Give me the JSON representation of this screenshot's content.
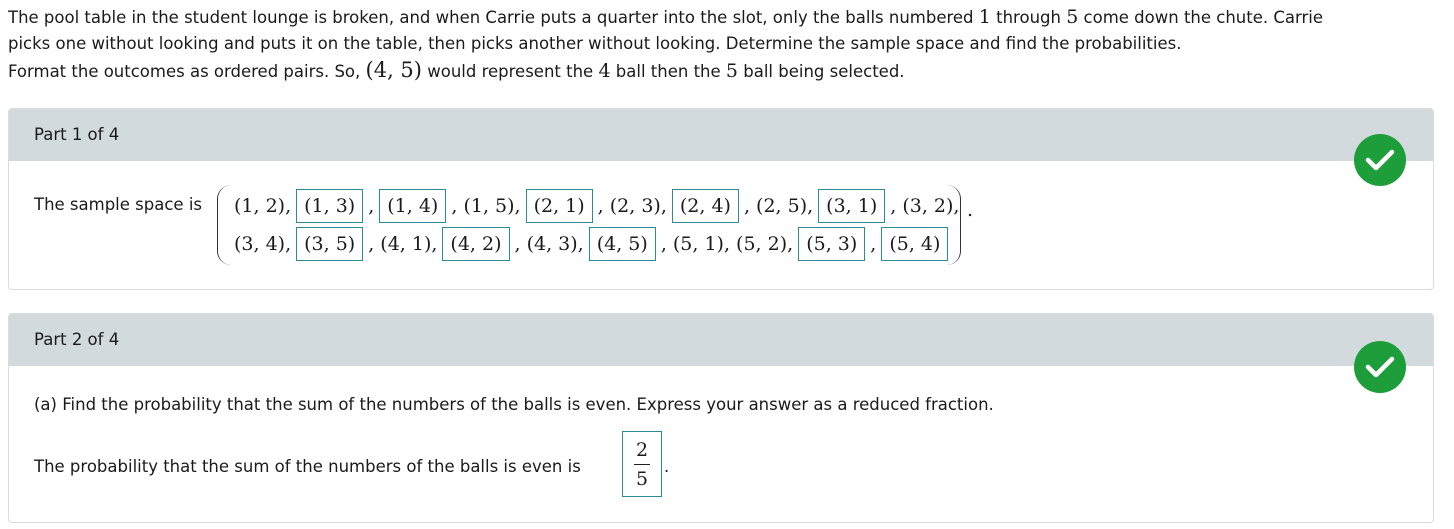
{
  "problem": {
    "line1_a": "The pool table in the student lounge is broken, and when Carrie puts a quarter into the slot, only the balls numbered ",
    "line1_n1": "1",
    "line1_b": " through ",
    "line1_n2": "5",
    "line1_c": " come down the chute. Carrie",
    "line2": "picks one without looking and puts it on the table, then picks another without looking. Determine the sample space and find the probabilities.",
    "line3_a": "Format the outcomes as ordered pairs. So, ",
    "line3_pair": "(4, 5)",
    "line3_b": " would represent the ",
    "line3_n1": "4",
    "line3_c": " ball then the ",
    "line3_n2": "5",
    "line3_d": " ball being selected."
  },
  "part1": {
    "header": "Part 1 of 4",
    "label": "The sample space is",
    "row1": [
      {
        "v": "(1, 2),",
        "boxed": false
      },
      {
        "v": "(1, 3)",
        "boxed": true
      },
      {
        "v": ",",
        "boxed": false
      },
      {
        "v": "(1, 4)",
        "boxed": true
      },
      {
        "v": ", (1, 5),",
        "boxed": false
      },
      {
        "v": "(2, 1)",
        "boxed": true
      },
      {
        "v": ", (2, 3),",
        "boxed": false
      },
      {
        "v": "(2, 4)",
        "boxed": true
      },
      {
        "v": ", (2, 5),",
        "boxed": false
      },
      {
        "v": "(3, 1)",
        "boxed": true
      },
      {
        "v": ", (3, 2),",
        "boxed": false
      }
    ],
    "row2": [
      {
        "v": "(3, 4),",
        "boxed": false
      },
      {
        "v": "(3, 5)",
        "boxed": true
      },
      {
        "v": ", (4, 1),",
        "boxed": false
      },
      {
        "v": "(4, 2)",
        "boxed": true
      },
      {
        "v": ", (4, 3),",
        "boxed": false
      },
      {
        "v": "(4, 5)",
        "boxed": true
      },
      {
        "v": ", (5, 1), (5, 2),",
        "boxed": false
      },
      {
        "v": "(5, 3)",
        "boxed": true
      },
      {
        "v": ",",
        "boxed": false
      },
      {
        "v": "(5, 4)",
        "boxed": true
      }
    ],
    "end": "."
  },
  "part2": {
    "header": "Part 2 of 4",
    "question": "(a) Find the probability that the sum of the numbers of the balls is even. Express your answer as a reduced fraction.",
    "answer_label": "The probability that the sum of the numbers of the balls is even is",
    "numerator": "2",
    "denominator": "5",
    "end": "."
  },
  "colors": {
    "header_bg": "#d2dadd",
    "check_green": "#1e9e3b",
    "box_border": "#2b8e96"
  },
  "icons": {
    "status": "checkmark-circle-icon"
  }
}
